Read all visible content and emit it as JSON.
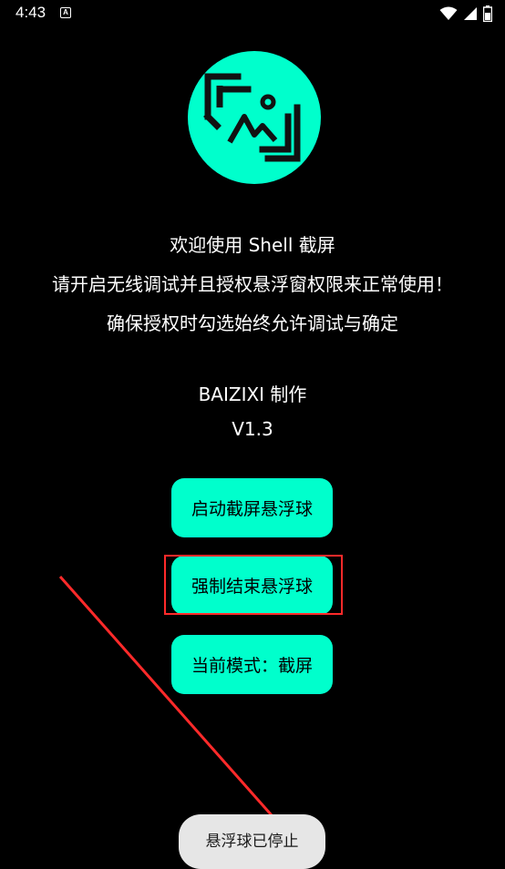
{
  "status_bar": {
    "time": "4:43",
    "notification_icon": "A",
    "icons": [
      "wifi-icon",
      "signal-icon",
      "battery-icon"
    ]
  },
  "app": {
    "logo_icon": "screenshot-logo-icon",
    "welcome": "欢迎使用 Shell 截屏",
    "instruction": "请开启无线调试并且授权悬浮窗权限来正常使用！",
    "confirm": "确保授权时勾选始终允许调试与确定",
    "author": "BAIZIXI 制作",
    "version": "V1.3"
  },
  "buttons": {
    "start": "启动截屏悬浮球",
    "stop": "强制结束悬浮球",
    "mode": "当前模式：截屏"
  },
  "toast": "悬浮球已停止",
  "colors": {
    "accent": "#00ffcc",
    "background": "#000000",
    "highlight": "#ff2a2a",
    "toast_bg": "#e6e6e6"
  }
}
